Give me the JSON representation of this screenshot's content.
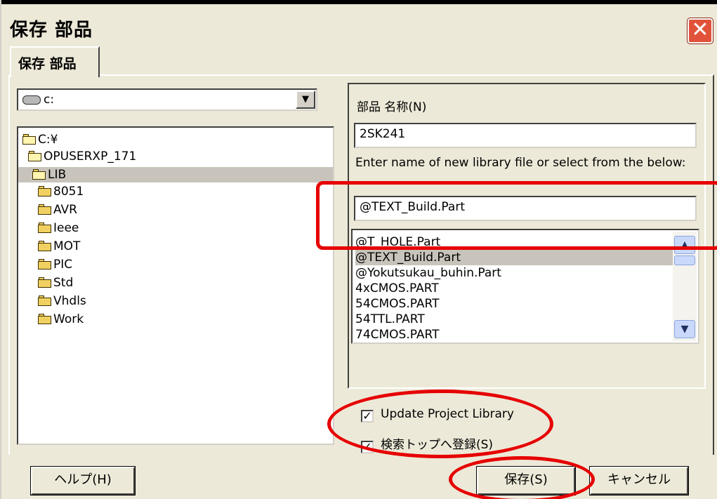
{
  "window": {
    "title": "保存 部品",
    "close_glyph": "✕"
  },
  "tab": {
    "label": "保存 部品"
  },
  "drive": {
    "value": "c:",
    "dropdown_glyph": "▼"
  },
  "folder_tree": [
    {
      "label": "C:¥",
      "open": true
    },
    {
      "label": "OPUSERXP_171",
      "open": true
    },
    {
      "label": "LIB",
      "open": true,
      "selected": true
    },
    {
      "label": "8051"
    },
    {
      "label": "AVR"
    },
    {
      "label": "Ieee"
    },
    {
      "label": "MOT"
    },
    {
      "label": "PIC"
    },
    {
      "label": "Std"
    },
    {
      "label": "Vhdls"
    },
    {
      "label": "Work"
    }
  ],
  "part_name": {
    "label": "部品 名称(N)",
    "value": "2SK241"
  },
  "library": {
    "instruction": "Enter name of new library file or select from the below:",
    "value": "@TEXT_Build.Part",
    "files": [
      {
        "label": "@T_HOLE.Part"
      },
      {
        "label": "@TEXT_Build.Part",
        "selected": true
      },
      {
        "label": "@Yokutsukau_buhin.Part"
      },
      {
        "label": "4xCMOS.PART"
      },
      {
        "label": "54CMOS.PART"
      },
      {
        "label": "54TTL.PART"
      },
      {
        "label": "74CMOS.PART"
      }
    ],
    "scroll_up_glyph": "▲",
    "scroll_down_glyph": "▼"
  },
  "options": {
    "update_project_library": {
      "label": "Update Project Library",
      "checked": true,
      "mark": "✓"
    },
    "register_search_top": {
      "label": "検索トップへ登録(S)",
      "checked": true,
      "mark": "✓"
    }
  },
  "buttons": {
    "help": "ヘルプ(H)",
    "save": "保存(S)",
    "cancel": "キャンセル"
  },
  "colors": {
    "annotation": "#e60000",
    "window_bg": "#ece9d8",
    "close_button": "#e0533a",
    "selection": "#c8c4bc"
  },
  "icons": {
    "close": "close-icon",
    "drive": "drive-icon",
    "folder": "folder-icon",
    "dropdown": "chevron-down-icon"
  }
}
